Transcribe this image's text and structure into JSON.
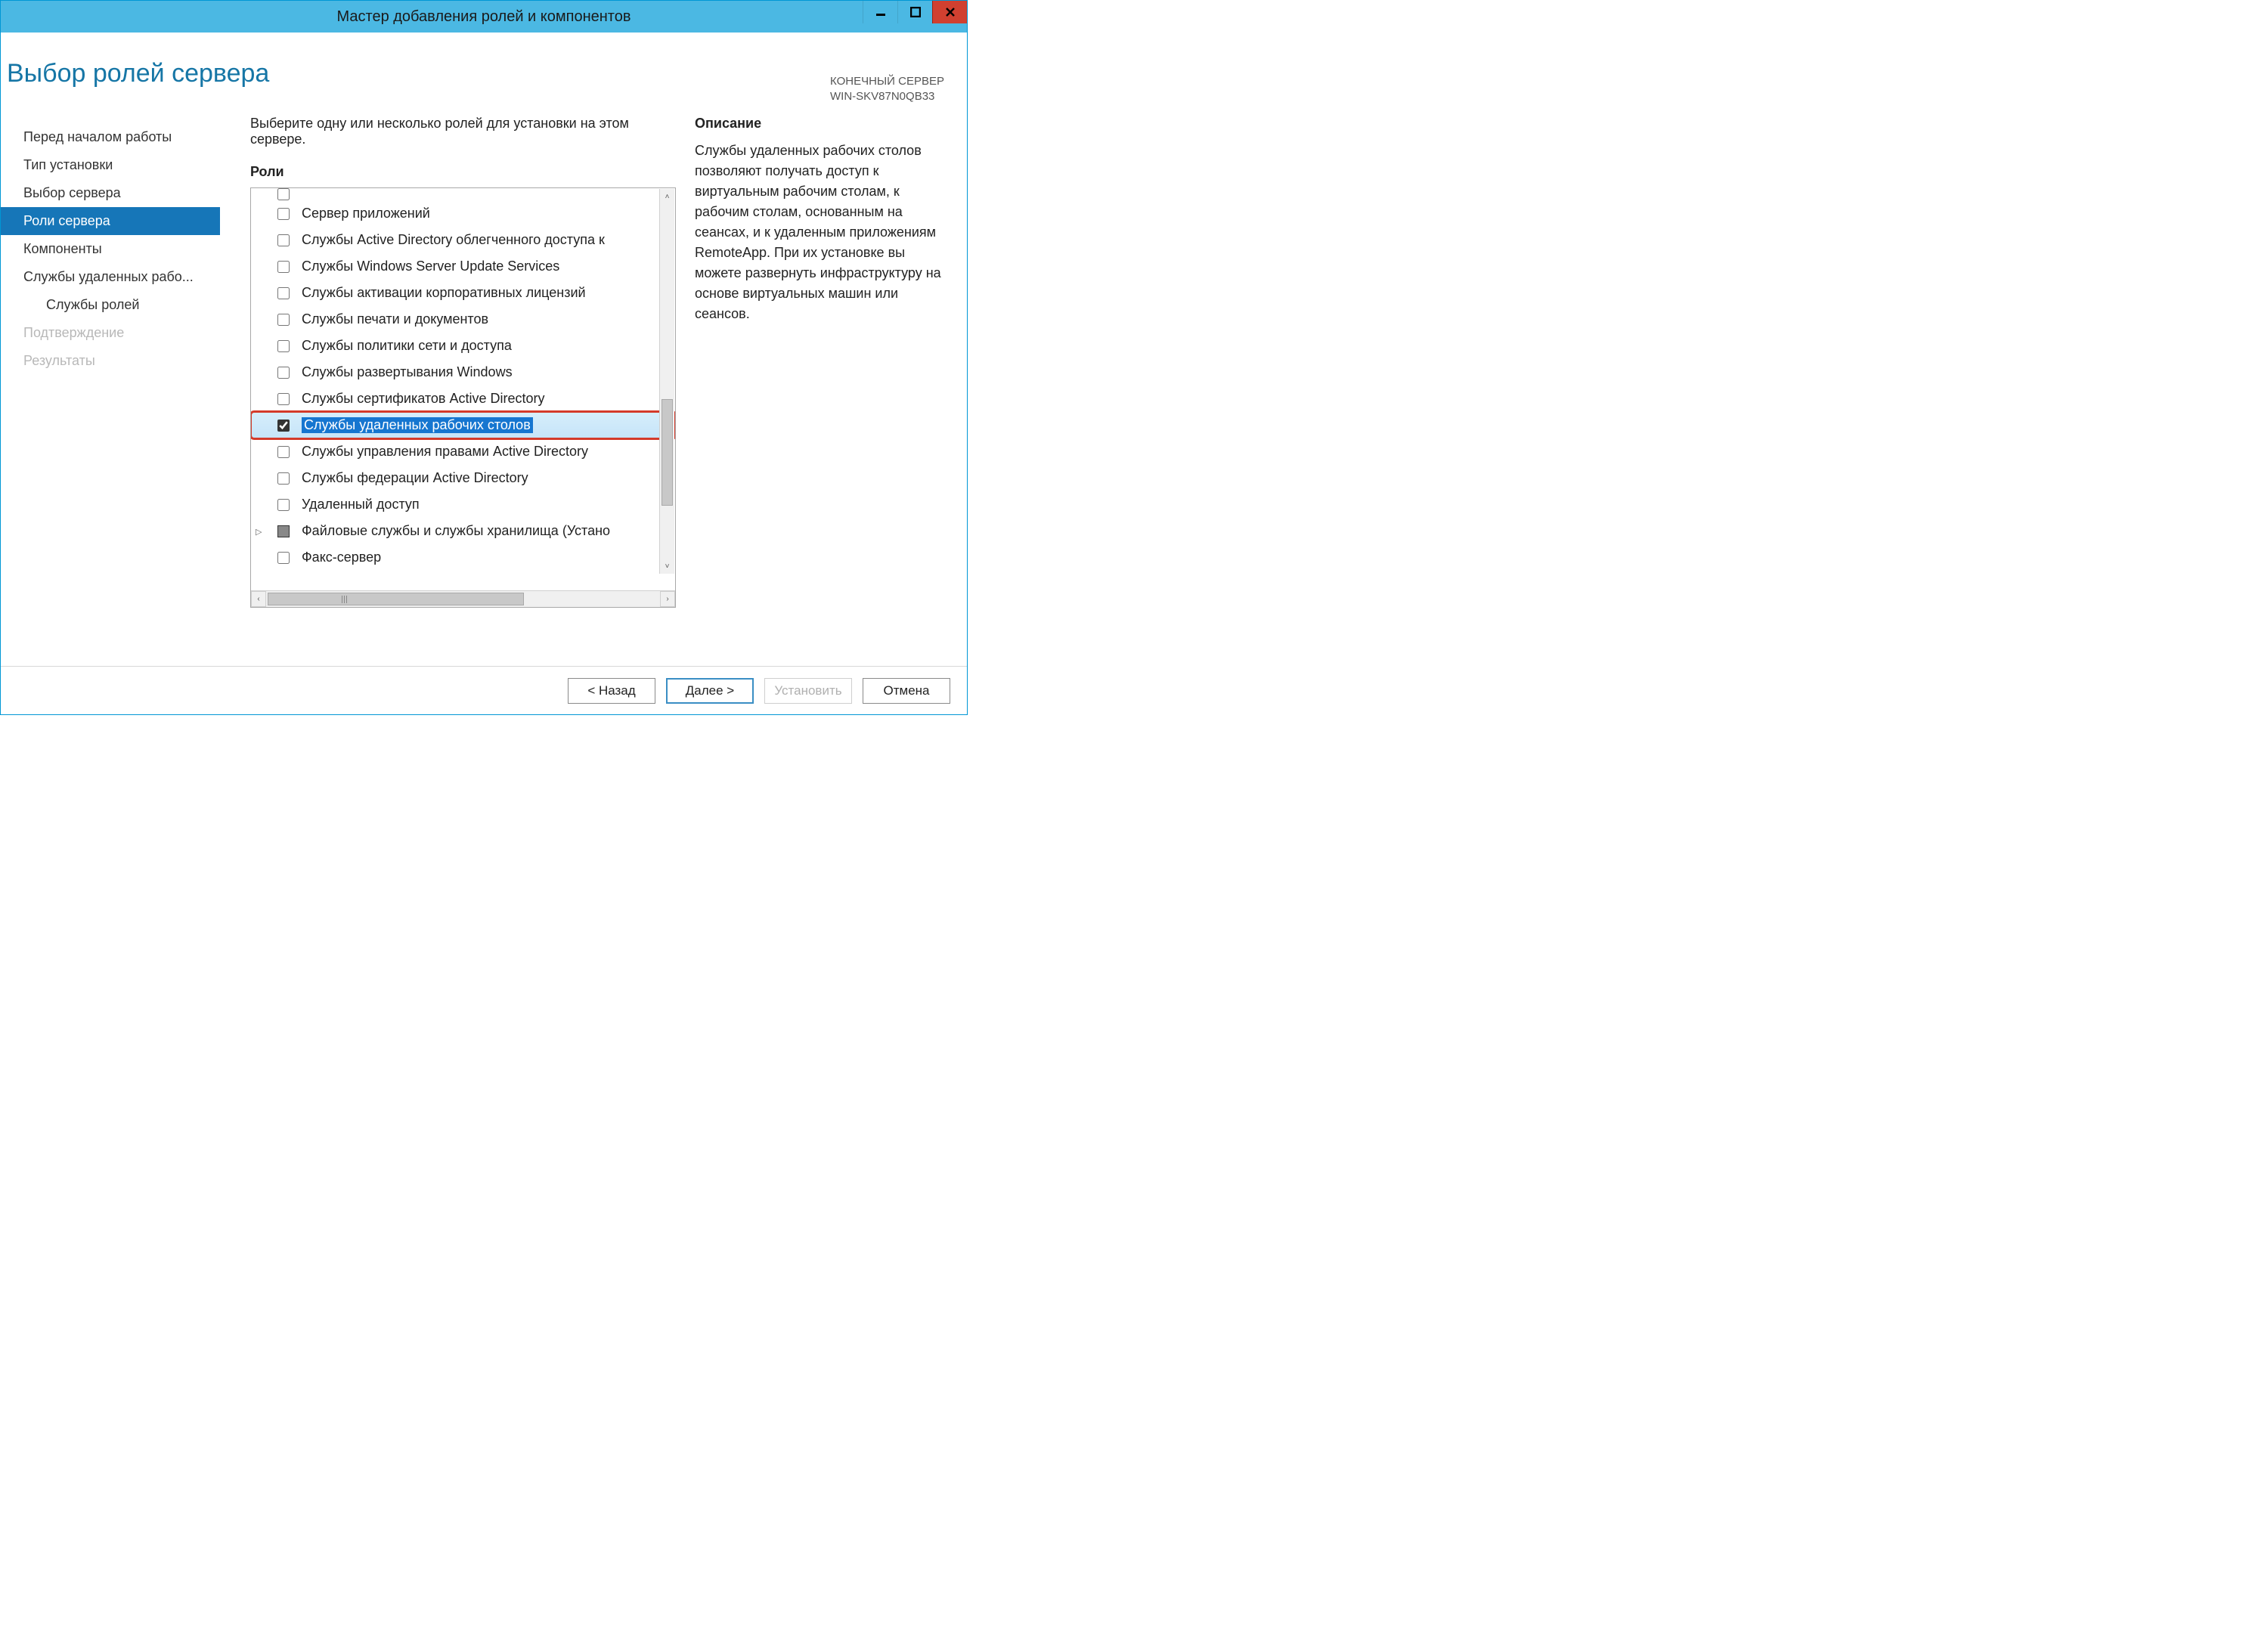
{
  "window": {
    "title": "Мастер добавления ролей и компонентов"
  },
  "header": {
    "page_title": "Выбор ролей сервера",
    "target_label": "КОНЕЧНЫЙ СЕРВЕР",
    "target_server": "WIN-SKV87N0QB33"
  },
  "sidebar": {
    "items": [
      {
        "label": "Перед началом работы",
        "state": "normal"
      },
      {
        "label": "Тип установки",
        "state": "normal"
      },
      {
        "label": "Выбор сервера",
        "state": "normal"
      },
      {
        "label": "Роли сервера",
        "state": "active"
      },
      {
        "label": "Компоненты",
        "state": "normal"
      },
      {
        "label": "Службы удаленных рабо...",
        "state": "normal"
      },
      {
        "label": "Службы ролей",
        "state": "normal",
        "indent": true
      },
      {
        "label": "Подтверждение",
        "state": "disabled"
      },
      {
        "label": "Результаты",
        "state": "disabled"
      }
    ]
  },
  "main": {
    "instruction": "Выберите одну или несколько ролей для установки на этом сервере.",
    "roles_label": "Роли",
    "roles": [
      {
        "label": "Сервер приложений",
        "checked": false
      },
      {
        "label": "Службы Active Directory облегченного доступа к",
        "checked": false
      },
      {
        "label": "Службы Windows Server Update Services",
        "checked": false
      },
      {
        "label": "Службы активации корпоративных лицензий",
        "checked": false
      },
      {
        "label": "Службы печати и документов",
        "checked": false
      },
      {
        "label": "Службы политики сети и доступа",
        "checked": false
      },
      {
        "label": "Службы развертывания Windows",
        "checked": false
      },
      {
        "label": "Службы сертификатов Active Directory",
        "checked": false
      },
      {
        "label": "Службы удаленных рабочих столов",
        "checked": true,
        "selected": true,
        "highlighted": true
      },
      {
        "label": "Службы управления правами Active Directory",
        "checked": false
      },
      {
        "label": "Службы федерации Active Directory",
        "checked": false
      },
      {
        "label": "Удаленный доступ",
        "checked": false
      },
      {
        "label": "Файловые службы и службы хранилища (Устано",
        "checked": "indeterminate",
        "expandable": true
      },
      {
        "label": "Факс-сервер",
        "checked": false
      }
    ]
  },
  "description": {
    "label": "Описание",
    "text": "Службы удаленных рабочих столов позволяют получать доступ к виртуальным рабочим столам, к рабочим столам, основанным на сеансах, и к удаленным приложениям RemoteApp. При их установке вы можете развернуть инфраструктуру на основе виртуальных машин или сеансов."
  },
  "footer": {
    "back": "< Назад",
    "next": "Далее >",
    "install": "Установить",
    "cancel": "Отмена"
  }
}
